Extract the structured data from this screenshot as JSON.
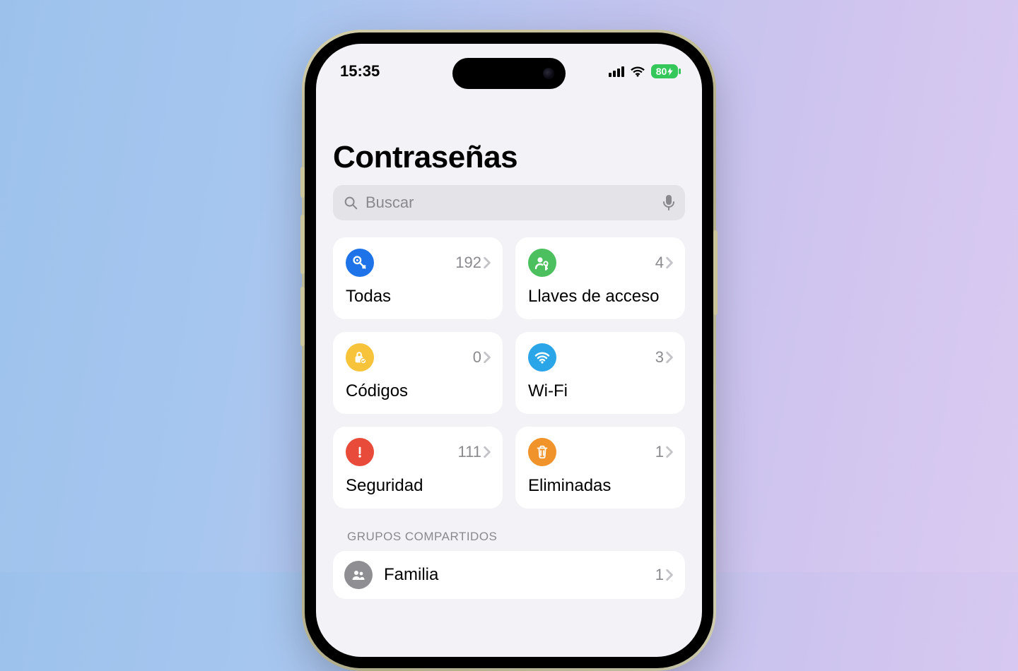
{
  "status": {
    "time": "15:35",
    "battery": "80"
  },
  "header": {
    "title": "Contraseñas"
  },
  "search": {
    "placeholder": "Buscar"
  },
  "tiles": [
    {
      "id": "all",
      "label": "Todas",
      "count": "192",
      "icon": "key-icon",
      "color": "ic-blue"
    },
    {
      "id": "passkeys",
      "label": "Llaves de acceso",
      "count": "4",
      "icon": "passkey-icon",
      "color": "ic-green"
    },
    {
      "id": "codes",
      "label": "Códigos",
      "count": "0",
      "icon": "lock-icon",
      "color": "ic-yellow"
    },
    {
      "id": "wifi",
      "label": "Wi-Fi",
      "count": "3",
      "icon": "wifi-icon",
      "color": "ic-sky"
    },
    {
      "id": "security",
      "label": "Seguridad",
      "count": "111",
      "icon": "alert-icon",
      "color": "ic-red"
    },
    {
      "id": "deleted",
      "label": "Eliminadas",
      "count": "1",
      "icon": "trash-icon",
      "color": "ic-orange"
    }
  ],
  "sections": {
    "sharedGroups": {
      "header": "GRUPOS COMPARTIDOS",
      "items": [
        {
          "id": "family",
          "label": "Familia",
          "count": "1",
          "icon": "group-icon",
          "color": "ic-gray"
        }
      ]
    }
  }
}
